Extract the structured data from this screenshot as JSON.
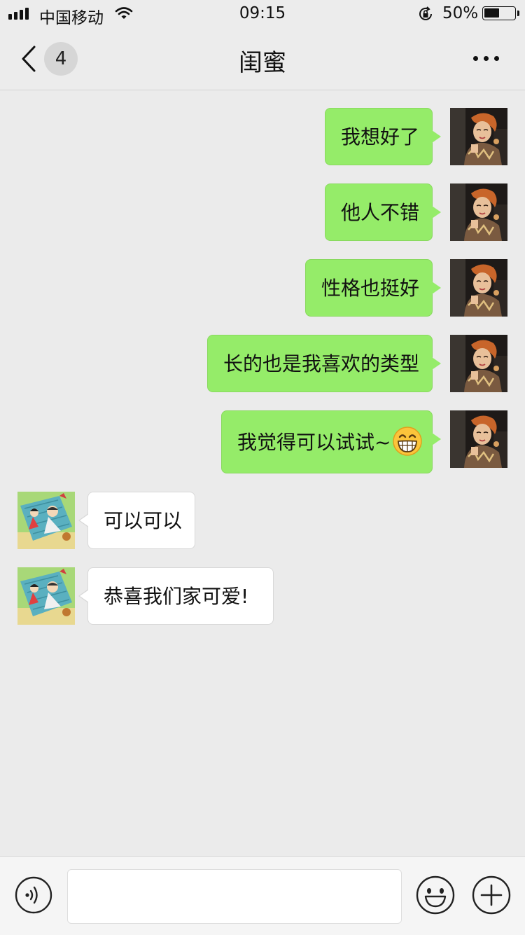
{
  "status_bar": {
    "carrier": "中国移动",
    "time": "09:15",
    "battery_percent_label": "50%",
    "battery_level": 0.5,
    "icons": [
      "signal-icon",
      "wifi-icon",
      "rotation-lock-icon",
      "battery-icon"
    ]
  },
  "nav": {
    "back_icon": "chevron-left-icon",
    "unread_count": "4",
    "title": "闺蜜",
    "more_icon": "ellipsis-icon"
  },
  "messages": [
    {
      "side": "out",
      "text": "我想好了"
    },
    {
      "side": "out",
      "text": "他人不错"
    },
    {
      "side": "out",
      "text": "性格也挺好"
    },
    {
      "side": "out",
      "text": "长的也是我喜欢的类型"
    },
    {
      "side": "out",
      "text": "我觉得可以试试~",
      "emoji": "grinning-face-emoji"
    },
    {
      "side": "in",
      "text": "可以可以"
    },
    {
      "side": "in",
      "text": "恭喜我们家可爱!"
    }
  ],
  "input_bar": {
    "voice_icon": "voice-icon",
    "text_value": "",
    "emoji_icon": "smiley-icon",
    "plus_icon": "plus-icon"
  },
  "colors": {
    "background": "#ebebeb",
    "outgoing_bubble": "#95ec69",
    "incoming_bubble": "#ffffff",
    "bar": "#ececec"
  }
}
